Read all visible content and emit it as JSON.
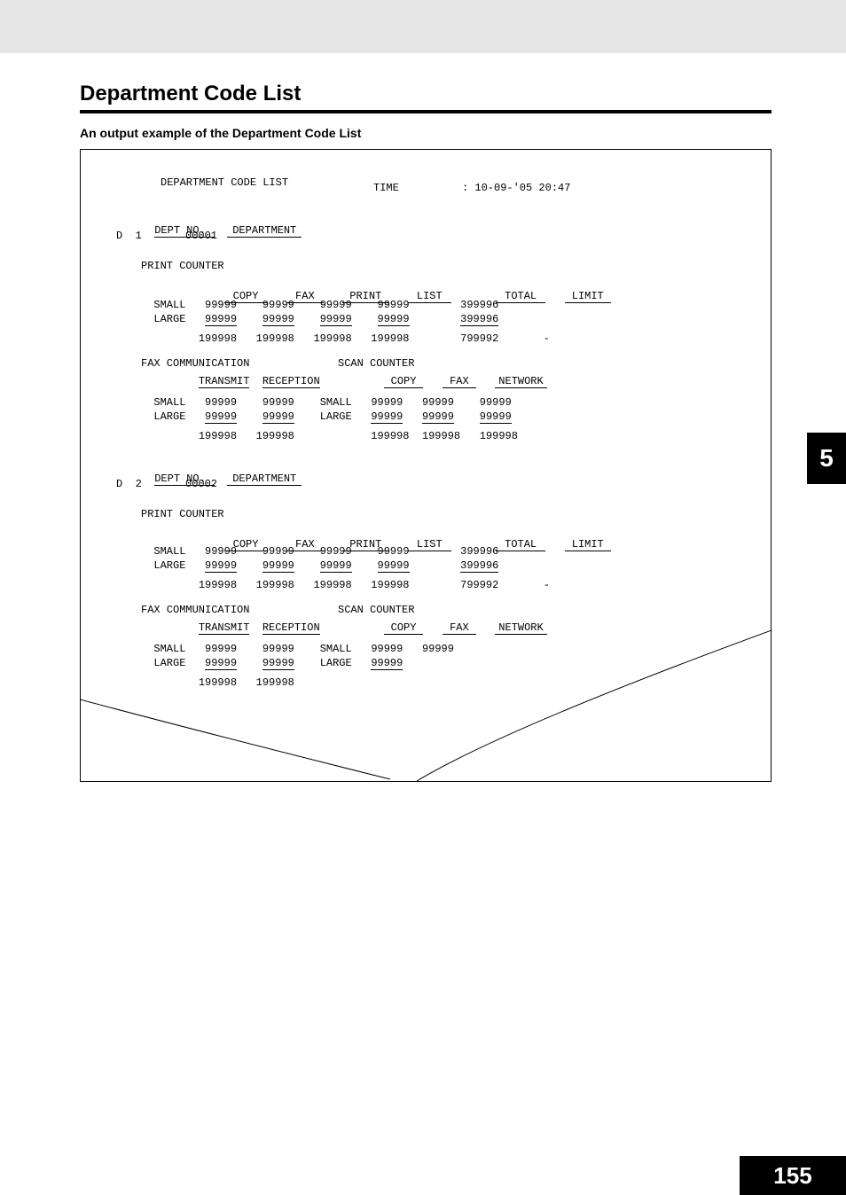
{
  "page": {
    "title": "Department Code List",
    "subtitle": "An output example of the Department Code List",
    "chapter_tab": "5",
    "page_number": "155"
  },
  "report": {
    "header_title": "DEPARTMENT CODE LIST",
    "time_label": "TIME",
    "time_value": ": 10-09-'05 20:47",
    "dept_header_labels": {
      "no": "DEPT NO.",
      "name": "DEPARTMENT"
    },
    "print_counter_label": "PRINT COUNTER",
    "print_counter_cols": {
      "copy": "COPY",
      "fax": "FAX",
      "print": "PRINT",
      "list": "LIST",
      "total": "TOTAL",
      "limit": "LIMIT"
    },
    "row_labels": {
      "small": "SMALL",
      "large": "LARGE"
    },
    "fax_comm_label": "FAX COMMUNICATION",
    "fax_comm_cols": {
      "transmit": "TRANSMIT",
      "reception": "RECEPTION"
    },
    "scan_counter_label": "SCAN COUNTER",
    "scan_counter_cols": {
      "copy": "COPY",
      "fax": "FAX",
      "network": "NETWORK"
    },
    "departments": [
      {
        "dept_no": "D  1",
        "dept_name": "00001",
        "print_counter": {
          "small": {
            "copy": "99999",
            "fax": "99999",
            "print": "99999",
            "list": "99999",
            "total": "399996",
            "limit": ""
          },
          "large": {
            "copy": "99999",
            "fax": "99999",
            "print": "99999",
            "list": "99999",
            "total": "399996",
            "limit": ""
          },
          "totals": {
            "copy": "199998",
            "fax": "199998",
            "print": "199998",
            "list": "199998",
            "total": "799992",
            "limit": "-"
          }
        },
        "fax_comm": {
          "small": {
            "transmit": "99999",
            "reception": "99999"
          },
          "large": {
            "transmit": "99999",
            "reception": "99999"
          },
          "totals": {
            "transmit": "199998",
            "reception": "199998"
          }
        },
        "scan_counter": {
          "small": {
            "copy": "99999",
            "fax": "99999",
            "network": "99999"
          },
          "large": {
            "copy": "99999",
            "fax": "99999",
            "network": "99999"
          },
          "totals": {
            "copy": "199998",
            "fax": "199998",
            "network": "199998"
          }
        }
      },
      {
        "dept_no": "D  2",
        "dept_name": "00002",
        "print_counter": {
          "small": {
            "copy": "99999",
            "fax": "99999",
            "print": "99999",
            "list": "99999",
            "total": "399996",
            "limit": ""
          },
          "large": {
            "copy": "99999",
            "fax": "99999",
            "print": "99999",
            "list": "99999",
            "total": "399996",
            "limit": ""
          },
          "totals": {
            "copy": "199998",
            "fax": "199998",
            "print": "199998",
            "list": "199998",
            "total": "799992",
            "limit": "-"
          }
        },
        "fax_comm": {
          "small": {
            "transmit": "99999",
            "reception": "99999"
          },
          "large": {
            "transmit": "99999",
            "reception": "99999"
          },
          "totals": {
            "transmit": "199998",
            "reception": "199998"
          }
        },
        "scan_counter": {
          "small": {
            "copy": "99999",
            "fax": "99999",
            "network": ""
          },
          "large": {
            "copy": "99999",
            "fax": "",
            "network": ""
          },
          "totals": {
            "copy": "",
            "fax": "",
            "network": ""
          }
        }
      }
    ]
  }
}
